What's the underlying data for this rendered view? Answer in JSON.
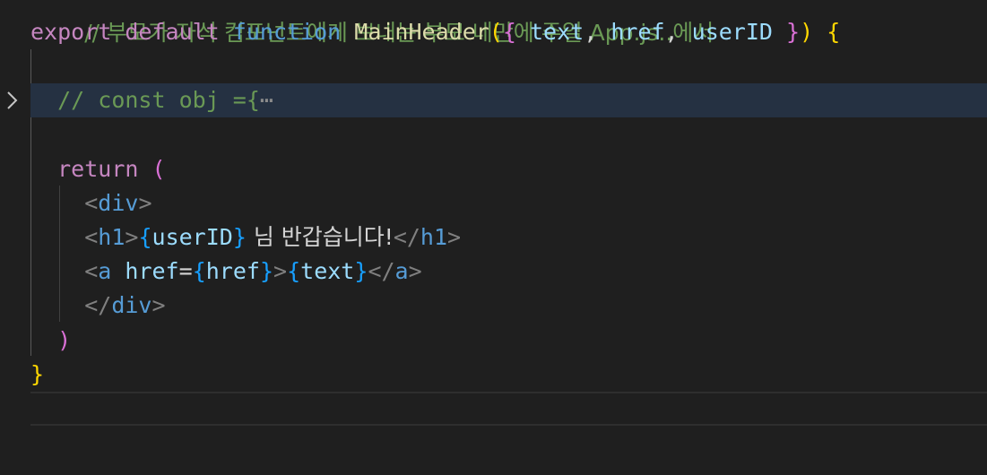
{
  "editor": {
    "line0": {
      "text": "// 부모가 자식 컴포넌트에게 보내는 부모 네만에 주일 App.js..에서"
    },
    "line1": {
      "export": "export",
      "default": "default",
      "function": "function",
      "name": "MainHeader",
      "open_paren": "(",
      "open_brace": "{",
      "p1": "text",
      "comma1": ", ",
      "p2": "href",
      "comma2": ", ",
      "p3": "userID",
      "close_brace": "}",
      "close_paren": ")",
      "body_brace": "{"
    },
    "line3": {
      "comment": "// const obj ={",
      "ellipsis": "⋯"
    },
    "line5": {
      "return": "return",
      "paren": "("
    },
    "line6": {
      "lt": "<",
      "tag": "div",
      "gt": ">"
    },
    "line7": {
      "lt": "<",
      "tag": "h1",
      "gt": ">",
      "open": "{",
      "var": "userID",
      "close": "}",
      "text": " 님 반갑습니다!",
      "lt_close": "</",
      "tag_close": "h1",
      "gt_close": ">"
    },
    "line8": {
      "lt": "<",
      "tag": "a",
      "attr": "href",
      "eq": "=",
      "open1": "{",
      "var1": "href",
      "close1": "}",
      "gt": ">",
      "open2": "{",
      "var2": "text",
      "close2": "}",
      "lt_close": "</",
      "tag_close": "a",
      "gt_close": ">"
    },
    "line9": {
      "lt_close": "</",
      "tag": "div",
      "gt": ">"
    },
    "line10": {
      "paren": ")"
    },
    "line11": {
      "brace": "}"
    }
  },
  "colors": {
    "background": "#1f1f1f",
    "line_highlight": "#253142",
    "keyword_purple": "#c586c0",
    "keyword_blue": "#569cd6",
    "function": "#dcdcaa",
    "variable": "#9cdcfe",
    "comment": "#6a9955",
    "bracket_yellow": "#ffd700",
    "bracket_pink": "#da70d6",
    "bracket_blue": "#179fff"
  },
  "icons": {
    "fold": "chevron-right-icon"
  }
}
